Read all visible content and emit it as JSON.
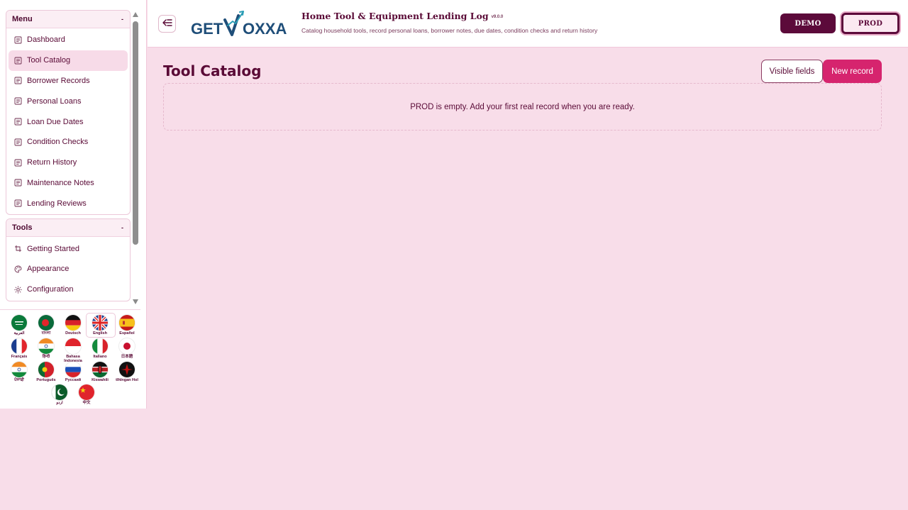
{
  "sidebar": {
    "menu": {
      "title": "Menu",
      "collapse_glyph": "-",
      "items": [
        {
          "label": "Dashboard",
          "icon": "document-icon"
        },
        {
          "label": "Tool Catalog",
          "icon": "document-icon",
          "active": true
        },
        {
          "label": "Borrower Records",
          "icon": "document-icon"
        },
        {
          "label": "Personal Loans",
          "icon": "document-icon"
        },
        {
          "label": "Loan Due Dates",
          "icon": "document-icon"
        },
        {
          "label": "Condition Checks",
          "icon": "document-icon"
        },
        {
          "label": "Return History",
          "icon": "document-icon"
        },
        {
          "label": "Maintenance Notes",
          "icon": "document-icon"
        },
        {
          "label": "Lending Reviews",
          "icon": "document-icon"
        }
      ]
    },
    "tools": {
      "title": "Tools",
      "collapse_glyph": "-",
      "items": [
        {
          "label": "Getting Started",
          "icon": "crop-icon"
        },
        {
          "label": "Appearance",
          "icon": "palette-icon"
        },
        {
          "label": "Configuration",
          "icon": "sun-icon"
        }
      ]
    },
    "languages": [
      {
        "label": "العربية",
        "flag": "sa"
      },
      {
        "label": "বাংলা",
        "flag": "bd"
      },
      {
        "label": "Deutsch",
        "flag": "de"
      },
      {
        "label": "English",
        "flag": "gb",
        "selected": true
      },
      {
        "label": "Español",
        "flag": "es"
      },
      {
        "label": "Français",
        "flag": "fr"
      },
      {
        "label": "हिन्दी",
        "flag": "in"
      },
      {
        "label": "Bahasa Indonesia",
        "flag": "id"
      },
      {
        "label": "Italiano",
        "flag": "it"
      },
      {
        "label": "日本語",
        "flag": "jp"
      },
      {
        "label": "ਪੰਜਾਬੀ",
        "flag": "in"
      },
      {
        "label": "Português",
        "flag": "pt"
      },
      {
        "label": "Русский",
        "flag": "ru"
      },
      {
        "label": "Kiswahili",
        "flag": "ke"
      },
      {
        "label": "tlhIngan Hol",
        "flag": "klingon"
      },
      {
        "label": "اردو",
        "flag": "pk"
      },
      {
        "label": "中文",
        "flag": "cn"
      }
    ]
  },
  "header": {
    "logo_text_a": "GET",
    "logo_text_b": "OXXA",
    "title": "Home Tool & Equipment Lending Log",
    "version": "v9.0.0",
    "subtitle": "Catalog household tools, record personal loans, borrower notes, due dates, condition checks and return history",
    "env_demo": "DEMO",
    "env_prod": "PROD",
    "collapse_icon": "sidebar-collapse-icon"
  },
  "main": {
    "title": "Tool Catalog",
    "visible_fields_label": "Visible fields",
    "new_record_label": "New record",
    "empty_message": "PROD is empty. Add your first real record when you are ready."
  },
  "colors": {
    "page_bg": "#f8dde9",
    "primary_dark": "#5c0a3a",
    "accent": "#d6246e",
    "logo_blue": "#1f4e79",
    "logo_teal": "#2a9db5"
  }
}
